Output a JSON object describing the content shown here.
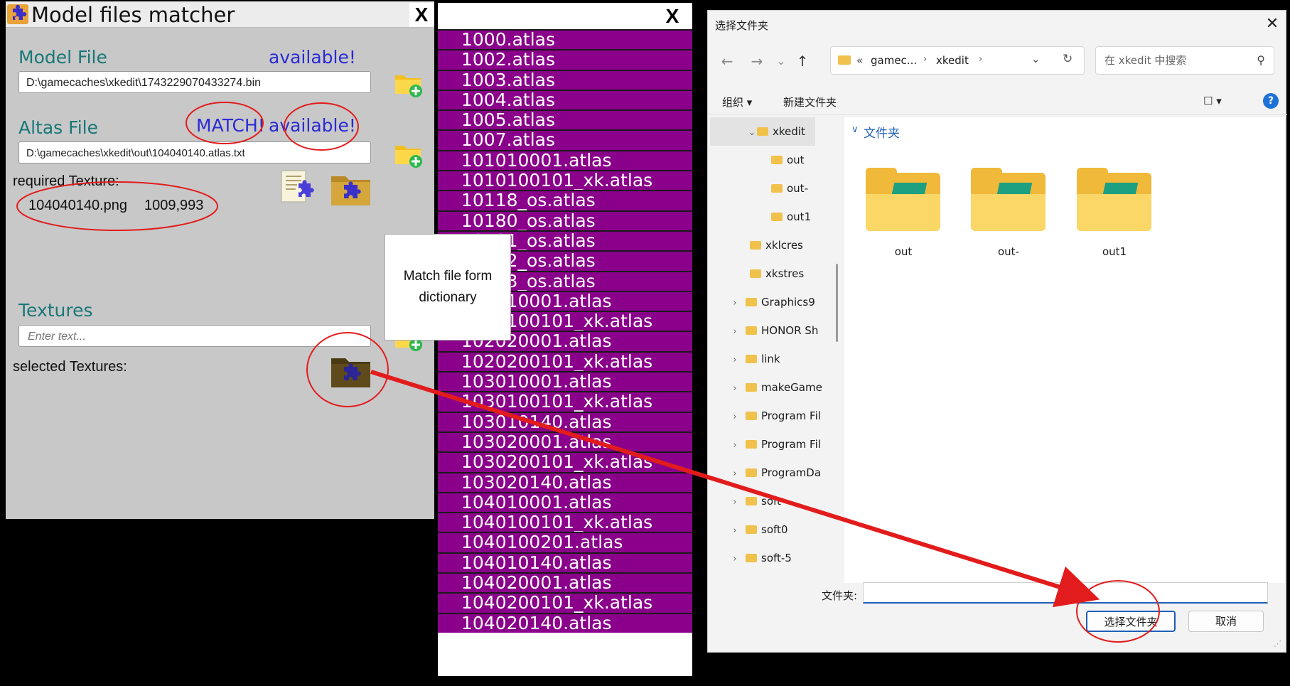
{
  "matcher": {
    "title": "Model files matcher",
    "close": "X",
    "model_file_label": "Model File",
    "model_available": "available!",
    "model_path": "D:\\gamecaches\\xkedit\\1743229070433274.bin",
    "atlas_file_label": "Altas File",
    "atlas_match": "MATCH!",
    "atlas_available": "available!",
    "atlas_path": "D:\\gamecaches\\xkedit\\out\\104040140.atlas.txt",
    "required_texture_label": "required Texture:",
    "required_texture_name": "104040140.png",
    "required_texture_size": "1009,993",
    "textures_label": "Textures",
    "textures_placeholder": "Enter text...",
    "selected_textures_label": "selected Textures:"
  },
  "atlas_list": {
    "close": "X",
    "items": [
      "1000.atlas",
      "1002.atlas",
      "1003.atlas",
      "1004.atlas",
      "1005.atlas",
      "1007.atlas",
      "101010001.atlas",
      "1010100101_xk.atlas",
      "10118_os.atlas",
      "10180_os.atlas",
      "10181_os.atlas",
      "10182_os.atlas",
      "10183_os.atlas",
      "102010001.atlas",
      "1020100101_xk.atlas",
      "102020001.atlas",
      "1020200101_xk.atlas",
      "103010001.atlas",
      "1030100101_xk.atlas",
      "103010140.atlas",
      "103020001.atlas",
      "1030200101_xk.atlas",
      "103020140.atlas",
      "104010001.atlas",
      "1040100101_xk.atlas",
      "1040100201.atlas",
      "104010140.atlas",
      "104020001.atlas",
      "1040200101_xk.atlas",
      "104020140.atlas"
    ]
  },
  "tooltip": {
    "text": "Match file form dictionary"
  },
  "dialog": {
    "title": "选择文件夹",
    "close": "✕",
    "breadcrumb_prefix": "«",
    "breadcrumb": [
      "gamec...",
      "xkedit"
    ],
    "search_placeholder": "在 xkedit 中搜索",
    "organize": "组织 ▾",
    "new_folder": "新建文件夹",
    "help": "?",
    "tree": [
      {
        "label": "xkedit",
        "level": 1,
        "expanded": true,
        "selected": true
      },
      {
        "label": "out",
        "level": 2
      },
      {
        "label": "out-",
        "level": 2
      },
      {
        "label": "out1",
        "level": 2
      },
      {
        "label": "xklcres",
        "level": 1
      },
      {
        "label": "xkstres",
        "level": 1
      },
      {
        "label": "Graphics9",
        "level": 0
      },
      {
        "label": "HONOR Sh",
        "level": 0
      },
      {
        "label": "link",
        "level": 0
      },
      {
        "label": "makeGame",
        "level": 0
      },
      {
        "label": "Program Fil",
        "level": 0
      },
      {
        "label": "Program Fil",
        "level": 0
      },
      {
        "label": "ProgramDa",
        "level": 0
      },
      {
        "label": "soft",
        "level": 0
      },
      {
        "label": "soft0",
        "level": 0
      },
      {
        "label": "soft-5",
        "level": 0
      }
    ],
    "section_header": "文件夹",
    "folders": [
      "out",
      "out-",
      "out1"
    ],
    "folder_field_label": "文件夹:",
    "select_button": "选择文件夹",
    "cancel_button": "取消"
  },
  "colors": {
    "list_bg": "#8a008a",
    "teal_label": "#1a7777",
    "blue_status": "#2b2bd6",
    "annotation_red": "#e21c1c",
    "accent_blue": "#1f5fb8"
  }
}
